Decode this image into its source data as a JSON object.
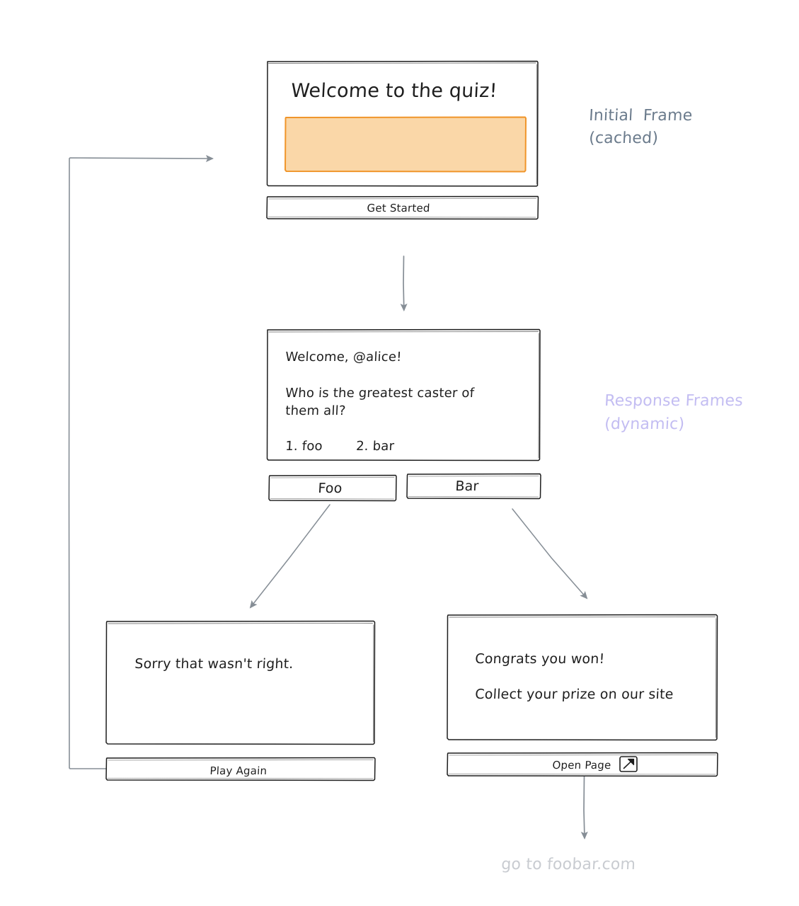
{
  "diagram": {
    "type": "flowchart",
    "background": "#ffffff",
    "stroke_color": "#1e1e1e",
    "arrow_color": "#868e96",
    "accent_fill": "#fad7a8",
    "accent_border": "#f0952a",
    "annotation_gray": "#6b7b8c",
    "annotation_purple": "#c3bdf2",
    "footer_gray": "#c9ccd1"
  },
  "frames": {
    "initial": {
      "title": "Welcome to the quiz!",
      "image_placeholder": "",
      "button": "Get Started"
    },
    "question": {
      "greeting": "Welcome, @alice!",
      "question_line1": "Who is the greatest caster of",
      "question_line2": "them all?",
      "options_line": "1. foo        2. bar",
      "option_1": "1. foo",
      "option_2": "2. bar",
      "button_left": "Foo",
      "button_right": "Bar"
    },
    "lose": {
      "message": "Sorry that wasn't right.",
      "button": "Play Again"
    },
    "win": {
      "line1": "Congrats you won!",
      "line2": "Collect your prize on our site",
      "button": "Open Page",
      "button_icon": "external-link-icon"
    }
  },
  "annotations": {
    "initial_frame_line1": "Initial  Frame",
    "initial_frame_line2": "(cached)",
    "response_frames_line1": "Response Frames",
    "response_frames_line2": "(dynamic)",
    "footer": "go to foobar.com"
  }
}
